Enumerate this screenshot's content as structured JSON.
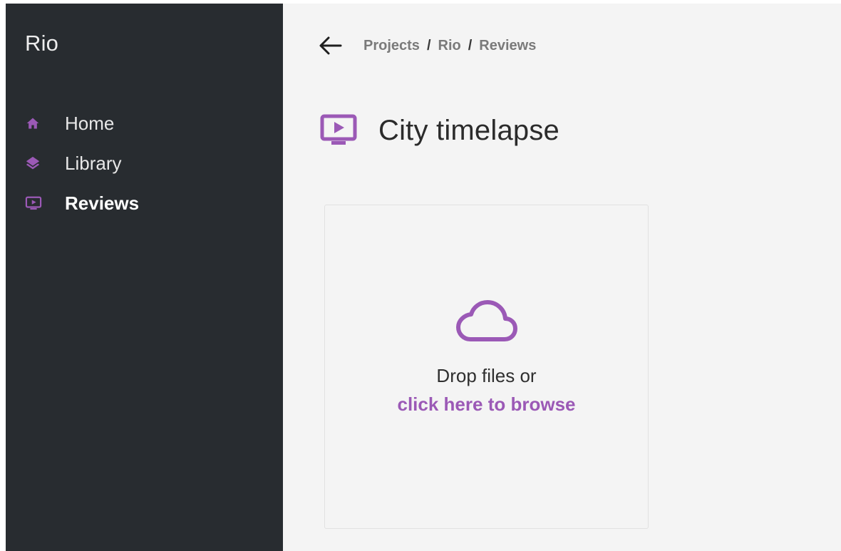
{
  "app": {
    "title": "Rio"
  },
  "sidebar": {
    "items": [
      {
        "label": "Home",
        "icon": "home-icon",
        "active": false
      },
      {
        "label": "Library",
        "icon": "layers-icon",
        "active": false
      },
      {
        "label": "Reviews",
        "icon": "monitor-play-icon",
        "active": true
      }
    ]
  },
  "breadcrumb": {
    "items": [
      "Projects",
      "Rio",
      "Reviews"
    ],
    "separator": "/"
  },
  "page": {
    "title": "City timelapse",
    "icon": "monitor-play-icon"
  },
  "dropzone": {
    "prompt": "Drop files or",
    "link": "click here to browse",
    "icon": "cloud-icon"
  },
  "colors": {
    "accent": "#9b59b6",
    "sidebar_bg": "#282c30",
    "main_bg": "#f4f4f4"
  }
}
